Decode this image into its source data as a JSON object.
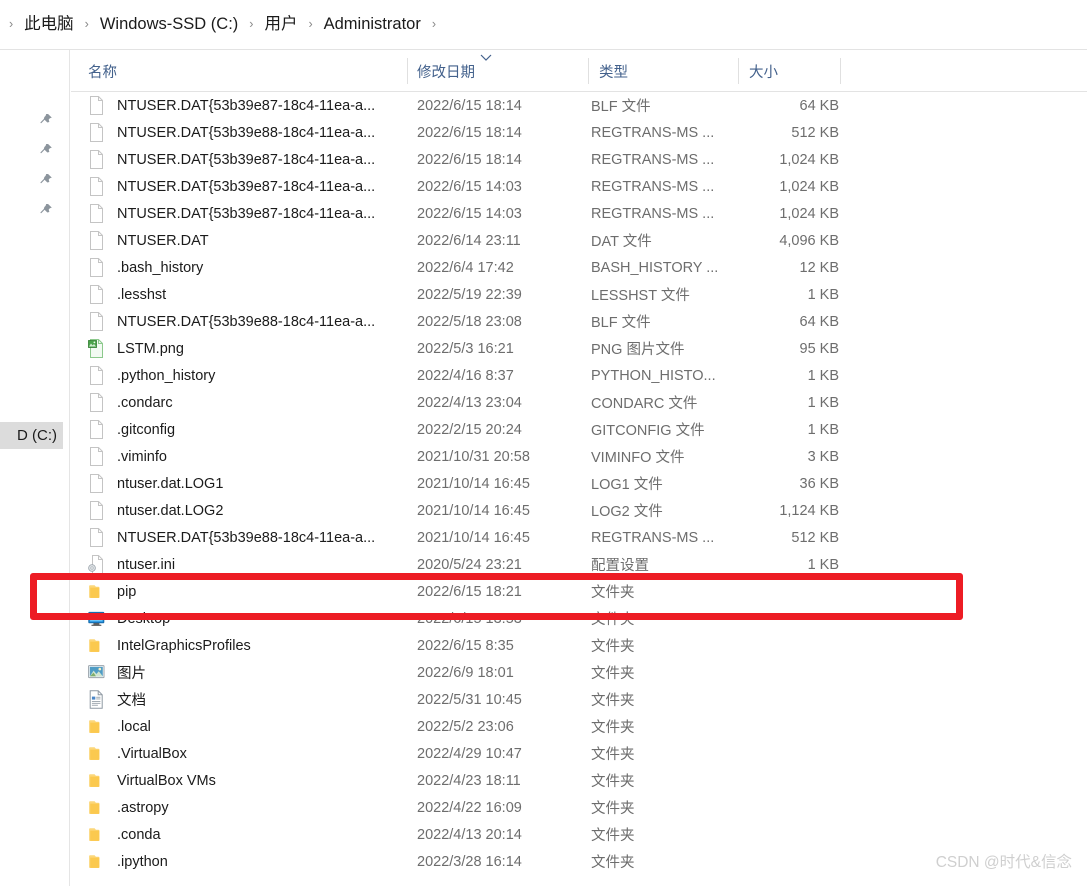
{
  "breadcrumb": {
    "name": "address-bar",
    "separator": "›",
    "items": [
      {
        "label": "此电脑"
      },
      {
        "label": "Windows-SSD (C:)"
      },
      {
        "label": "用户"
      },
      {
        "label": "Administrator"
      }
    ]
  },
  "navpane": {
    "pin_count": 4,
    "pin_icon": "pin-icon",
    "drive_label": "D (C:)"
  },
  "columns": {
    "name": "名称",
    "date": "修改日期",
    "type": "类型",
    "size": "大小",
    "sorted_by": "修改日期",
    "sort_direction": "descending",
    "sort_icon": "chevron-down-icon"
  },
  "files": [
    {
      "name": "NTUSER.DAT{53b39e87-18c4-11ea-a...",
      "date": "2022/6/15 18:14",
      "type": "BLF 文件",
      "size": "64 KB",
      "icon": "generic-file-icon"
    },
    {
      "name": "NTUSER.DAT{53b39e88-18c4-11ea-a...",
      "date": "2022/6/15 18:14",
      "type": "REGTRANS-MS ...",
      "size": "512 KB",
      "icon": "generic-file-icon"
    },
    {
      "name": "NTUSER.DAT{53b39e87-18c4-11ea-a...",
      "date": "2022/6/15 18:14",
      "type": "REGTRANS-MS ...",
      "size": "1,024 KB",
      "icon": "generic-file-icon"
    },
    {
      "name": "NTUSER.DAT{53b39e87-18c4-11ea-a...",
      "date": "2022/6/15 14:03",
      "type": "REGTRANS-MS ...",
      "size": "1,024 KB",
      "icon": "generic-file-icon"
    },
    {
      "name": "NTUSER.DAT{53b39e87-18c4-11ea-a...",
      "date": "2022/6/15 14:03",
      "type": "REGTRANS-MS ...",
      "size": "1,024 KB",
      "icon": "generic-file-icon"
    },
    {
      "name": "NTUSER.DAT",
      "date": "2022/6/14 23:11",
      "type": "DAT 文件",
      "size": "4,096 KB",
      "icon": "generic-file-icon"
    },
    {
      "name": ".bash_history",
      "date": "2022/6/4 17:42",
      "type": "BASH_HISTORY ...",
      "size": "12 KB",
      "icon": "generic-file-icon"
    },
    {
      "name": ".lesshst",
      "date": "2022/5/19 22:39",
      "type": "LESSHST 文件",
      "size": "1 KB",
      "icon": "generic-file-icon"
    },
    {
      "name": "NTUSER.DAT{53b39e88-18c4-11ea-a...",
      "date": "2022/5/18 23:08",
      "type": "BLF 文件",
      "size": "64 KB",
      "icon": "generic-file-icon"
    },
    {
      "name": "LSTM.png",
      "date": "2022/5/3 16:21",
      "type": "PNG 图片文件",
      "size": "95 KB",
      "icon": "png-image-file-icon"
    },
    {
      "name": ".python_history",
      "date": "2022/4/16 8:37",
      "type": "PYTHON_HISTO...",
      "size": "1 KB",
      "icon": "generic-file-icon"
    },
    {
      "name": ".condarc",
      "date": "2022/4/13 23:04",
      "type": "CONDARC 文件",
      "size": "1 KB",
      "icon": "generic-file-icon"
    },
    {
      "name": ".gitconfig",
      "date": "2022/2/15 20:24",
      "type": "GITCONFIG 文件",
      "size": "1 KB",
      "icon": "generic-file-icon"
    },
    {
      "name": ".viminfo",
      "date": "2021/10/31 20:58",
      "type": "VIMINFO 文件",
      "size": "3 KB",
      "icon": "generic-file-icon"
    },
    {
      "name": "ntuser.dat.LOG1",
      "date": "2021/10/14 16:45",
      "type": "LOG1 文件",
      "size": "36 KB",
      "icon": "generic-file-icon"
    },
    {
      "name": "ntuser.dat.LOG2",
      "date": "2021/10/14 16:45",
      "type": "LOG2 文件",
      "size": "1,124 KB",
      "icon": "generic-file-icon"
    },
    {
      "name": "NTUSER.DAT{53b39e88-18c4-11ea-a...",
      "date": "2021/10/14 16:45",
      "type": "REGTRANS-MS ...",
      "size": "512 KB",
      "icon": "generic-file-icon"
    },
    {
      "name": "ntuser.ini",
      "date": "2020/5/24 23:21",
      "type": "配置设置",
      "size": "1 KB",
      "icon": "config-settings-file-icon"
    },
    {
      "name": "pip",
      "date": "2022/6/15 18:21",
      "type": "文件夹",
      "size": "",
      "icon": "folder-icon",
      "highlighted": true
    },
    {
      "name": "Desktop",
      "date": "2022/6/15 13:53",
      "type": "文件夹",
      "size": "",
      "icon": "desktop-monitor-icon"
    },
    {
      "name": "IntelGraphicsProfiles",
      "date": "2022/6/15 8:35",
      "type": "文件夹",
      "size": "",
      "icon": "folder-icon"
    },
    {
      "name": "图片",
      "date": "2022/6/9 18:01",
      "type": "文件夹",
      "size": "",
      "icon": "pictures-folder-icon"
    },
    {
      "name": "文档",
      "date": "2022/5/31 10:45",
      "type": "文件夹",
      "size": "",
      "icon": "documents-folder-icon"
    },
    {
      "name": ".local",
      "date": "2022/5/2 23:06",
      "type": "文件夹",
      "size": "",
      "icon": "folder-icon"
    },
    {
      "name": ".VirtualBox",
      "date": "2022/4/29 10:47",
      "type": "文件夹",
      "size": "",
      "icon": "folder-icon"
    },
    {
      "name": "VirtualBox VMs",
      "date": "2022/4/23 18:11",
      "type": "文件夹",
      "size": "",
      "icon": "folder-icon"
    },
    {
      "name": ".astropy",
      "date": "2022/4/22 16:09",
      "type": "文件夹",
      "size": "",
      "icon": "folder-icon"
    },
    {
      "name": ".conda",
      "date": "2022/4/13 20:14",
      "type": "文件夹",
      "size": "",
      "icon": "folder-icon"
    },
    {
      "name": ".ipython",
      "date": "2022/3/28 16:14",
      "type": "文件夹",
      "size": "",
      "icon": "folder-icon"
    }
  ],
  "annotation": {
    "name": "red-highlight-box",
    "color": "#ed1c24",
    "target_row": "pip"
  },
  "watermark": {
    "text": "CSDN @时代&信念"
  }
}
